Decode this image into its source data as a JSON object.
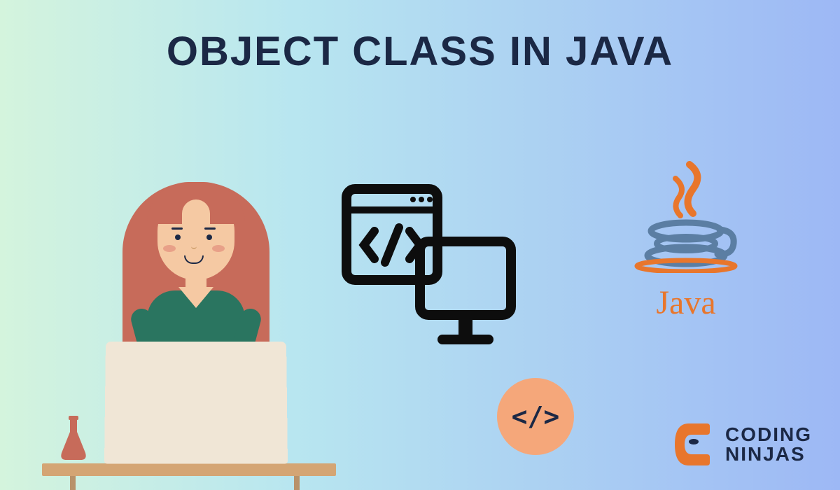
{
  "title": "OBJECT CLASS IN JAVA",
  "java_label": "Java",
  "code_symbol": "</>",
  "brand": {
    "line1": "CODING",
    "line2": "NINJAS"
  }
}
